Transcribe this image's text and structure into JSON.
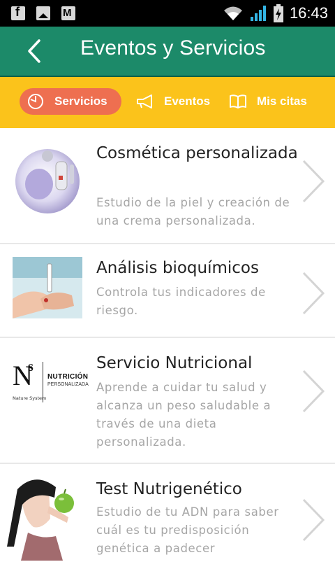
{
  "status_bar": {
    "time": "16:43",
    "icons": [
      "facebook-icon",
      "image-icon",
      "gmail-icon",
      "wifi-icon",
      "signal-icon",
      "battery-icon"
    ]
  },
  "header": {
    "title": "Eventos y Servicios",
    "color": "#1c8a69"
  },
  "tabs": {
    "color": "#fbc31b",
    "active_color": "#ee6f50",
    "items": [
      {
        "label": "Servicios",
        "icon": "clock-icon",
        "active": true
      },
      {
        "label": "Eventos",
        "icon": "megaphone-icon",
        "active": false
      },
      {
        "label": "Mis citas",
        "icon": "book-icon",
        "active": false
      }
    ]
  },
  "services": [
    {
      "title": "Cosmética personalizada",
      "description": "Estudio de la piel y creación de una crema personalizada."
    },
    {
      "title": "Análisis bioquímicos",
      "description": "Controla tus indicadores de riesgo."
    },
    {
      "title": "Servicio Nutricional",
      "description": "Aprende a cuidar tu salud y alcanza un peso saludable a través de una dieta personalizada.",
      "logo": {
        "mark": "N",
        "sup": "s",
        "caption": "Nature System",
        "line1": "NUTRICIÓN",
        "line2": "PERSONALIZADA"
      }
    },
    {
      "title": "Test Nutrigenético",
      "description": "Estudio de tu ADN para saber cuál es tu predisposición genética a padecer"
    }
  ]
}
